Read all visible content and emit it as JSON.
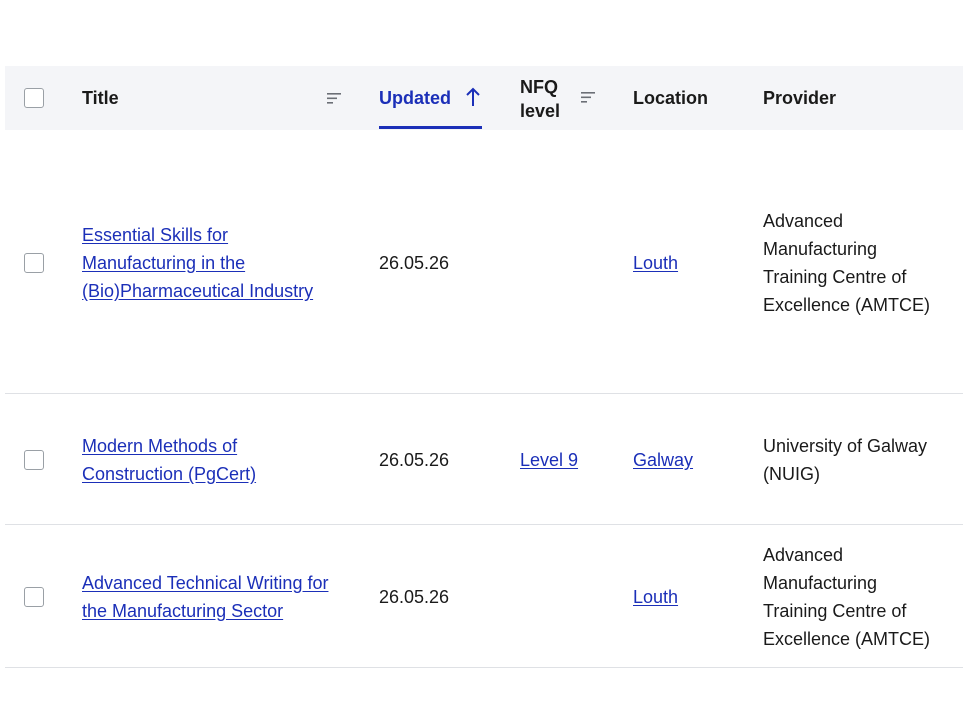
{
  "table": {
    "headers": {
      "title": "Title",
      "updated": "Updated",
      "nfq_level_line1": "NFQ",
      "nfq_level_line2": "level",
      "location": "Location",
      "provider": "Provider"
    },
    "sort": {
      "column": "Updated",
      "direction": "ascending"
    },
    "rows": [
      {
        "title_lines": [
          "Essential Skills for",
          "Manufacturing in the",
          "(Bio)Pharmaceutical Industry"
        ],
        "updated": "26.05.26",
        "nfq_level": "",
        "location": "Louth",
        "provider_lines": [
          "Advanced",
          "Manufacturing",
          "Training Centre of",
          "Excellence (AMTCE)"
        ]
      },
      {
        "title_lines": [
          "Modern Methods of",
          "Construction (PgCert)"
        ],
        "updated": "26.05.26",
        "nfq_level": "Level 9",
        "location": "Galway",
        "provider_lines": [
          "University of Galway",
          "(NUIG)"
        ]
      },
      {
        "title_lines": [
          "Advanced Technical Writing for",
          "the Manufacturing Sector"
        ],
        "updated": "26.05.26",
        "nfq_level": "",
        "location": "Louth",
        "provider_lines": [
          "Advanced",
          "Manufacturing",
          "Training Centre of",
          "Excellence (AMTCE)"
        ]
      }
    ]
  },
  "colors": {
    "link": "#1b2fb8",
    "header_bg": "#f4f5f8",
    "divider": "#dfe1e5"
  }
}
